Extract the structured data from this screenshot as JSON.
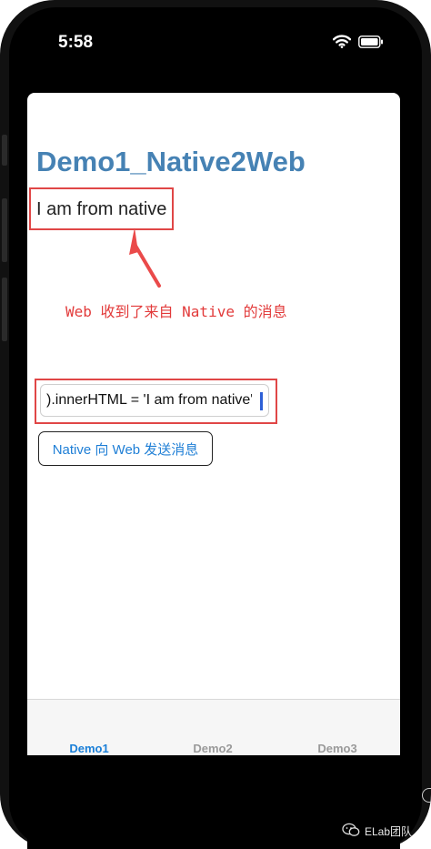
{
  "status_bar": {
    "time": "5:58",
    "icons": [
      "wifi-icon",
      "battery-icon"
    ]
  },
  "page": {
    "title": "Demo1_Native2Web",
    "native_message": "I am from native"
  },
  "annotation": {
    "text": "Web 收到了来自 Native 的消息",
    "color": "#e23a3a"
  },
  "input": {
    "value": ").innerHTML = 'I am from native';"
  },
  "send_button": {
    "label": "Native 向 Web 发送消息"
  },
  "tab_bar": {
    "tabs": [
      {
        "label": "Demo1",
        "active": true
      },
      {
        "label": "Demo2",
        "active": false
      },
      {
        "label": "Demo3",
        "active": false
      }
    ]
  },
  "watermark": {
    "text": "ELab团队"
  },
  "colors": {
    "title": "#4682b4",
    "highlight_box": "#e04646",
    "tab_active": "#1a7fd8",
    "tab_inactive": "#9a9a9a",
    "button_text": "#1f7fd6"
  }
}
